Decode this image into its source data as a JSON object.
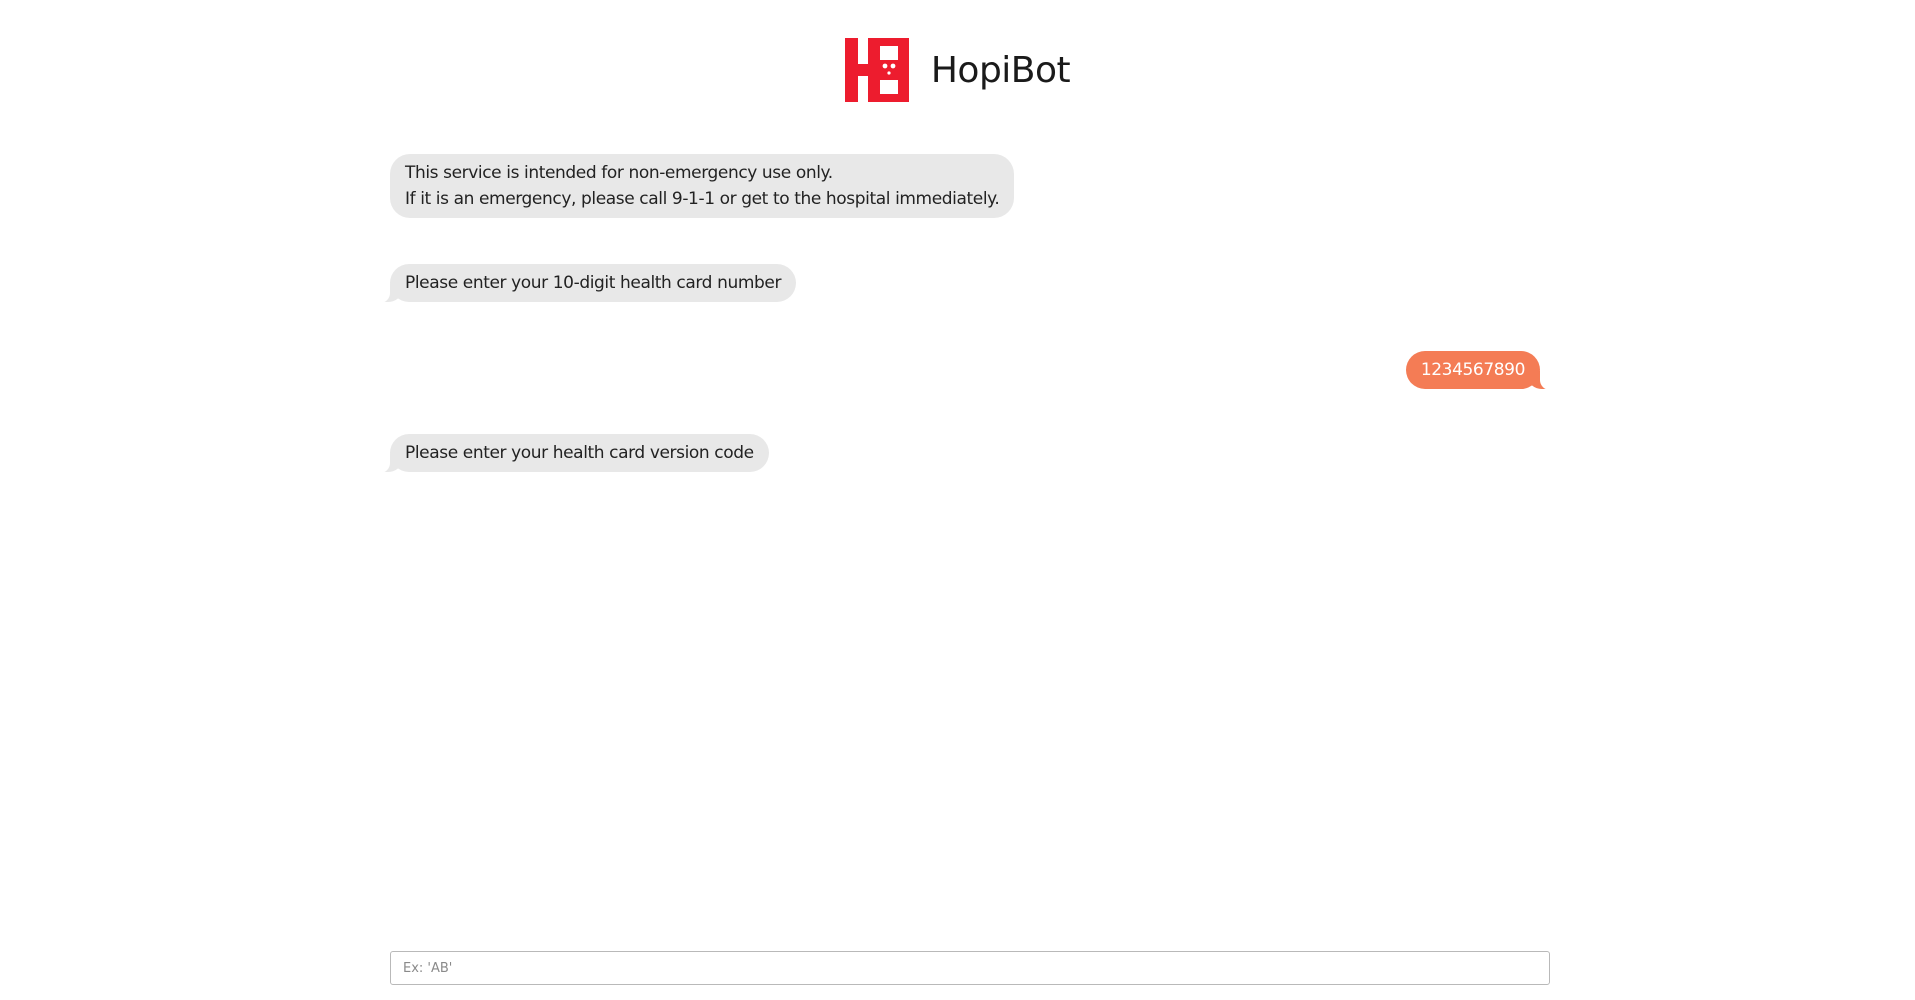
{
  "header": {
    "title": "HopiBot",
    "logo_icon": "hopibot-logo-icon",
    "brand_color": "#ed1c2e"
  },
  "conversation": {
    "messages": [
      {
        "sender": "bot",
        "lines": [
          "This service is intended for non-emergency use only.",
          "If it is an emergency, please call 9-1-1 or get to the hospital immediately."
        ]
      },
      {
        "sender": "bot",
        "lines": [
          "Please enter your 10-digit health card number"
        ]
      },
      {
        "sender": "user",
        "lines": [
          "1234567890"
        ]
      },
      {
        "sender": "bot",
        "lines": [
          "Please enter your health card version code"
        ]
      }
    ],
    "bot_bubble_color": "#e8e8e8",
    "user_bubble_color": "#f47c55"
  },
  "input": {
    "value": "",
    "placeholder": "Ex: 'AB'"
  }
}
